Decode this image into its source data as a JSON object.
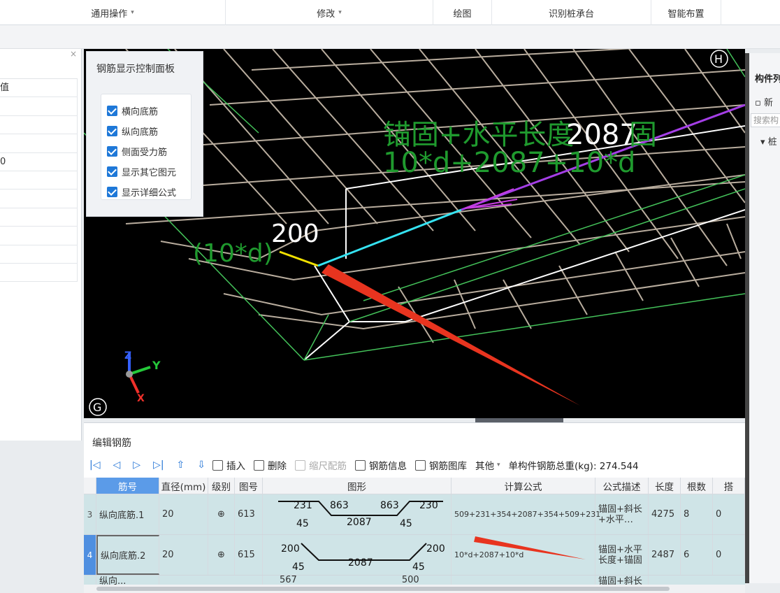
{
  "topbar": {
    "groups": [
      {
        "label": "通用操作",
        "caret": "▾"
      },
      {
        "label": "修改",
        "caret": "▾"
      },
      {
        "label": "绘图",
        "caret": ""
      },
      {
        "label": "识别桩承台",
        "caret": ""
      },
      {
        "label": "智能布置",
        "caret": ""
      }
    ]
  },
  "left_panel": {
    "close": "×",
    "rows": [
      "值",
      "",
      "",
      "",
      "0",
      "",
      "",
      "",
      "",
      "",
      ""
    ]
  },
  "viewport": {
    "anno_line1": "锚固+水平长度",
    "anno_value": "2087",
    "anno_tail": "固",
    "anno_line2": "10*d+2087+10*d",
    "dim_200": "200",
    "dim_10d": "(10*d)",
    "corner_h": "H",
    "corner_g": "G",
    "axis_x": "X",
    "axis_y": "Y",
    "axis_z": "Z"
  },
  "control_panel": {
    "title": "钢筋显示控制面板",
    "items": [
      {
        "label": "横向底筋",
        "checked": true
      },
      {
        "label": "纵向底筋",
        "checked": true
      },
      {
        "label": "侧面受力筋",
        "checked": true
      },
      {
        "label": "显示其它图元",
        "checked": true
      },
      {
        "label": "显示详细公式",
        "checked": true
      }
    ]
  },
  "right_panel": {
    "title": "构件列",
    "new_label": "新",
    "search_placeholder": "搜索构",
    "tree_item": "▾ 桩"
  },
  "bottom": {
    "title": "编辑钢筋",
    "toolbar": {
      "insert": "插入",
      "delete": "删除",
      "scale": "缩尺配筋",
      "rebar_info": "钢筋信息",
      "rebar_lib": "钢筋图库",
      "other": "其他",
      "total_label": "单构件钢筋总重(kg): 274.544"
    },
    "columns": [
      "筋号",
      "直径(mm)",
      "级别",
      "图号",
      "图形",
      "计算公式",
      "公式描述",
      "长度",
      "根数",
      "搭"
    ],
    "rows": [
      {
        "index": "3",
        "name": "纵向底筋.1",
        "diameter": "20",
        "grade": "⊕",
        "fig_no": "613",
        "shape": {
          "a": "231",
          "b": "863",
          "c": "863",
          "d": "230",
          "e": "45",
          "f": "2087",
          "g": "45"
        },
        "formula": "509+231+354+2087+354+509+231",
        "desc": "锚固+斜长+水平…",
        "length": "4275",
        "count": "8",
        "lap": "0"
      },
      {
        "index": "4",
        "name": "纵向底筋.2",
        "diameter": "20",
        "grade": "⊕",
        "fig_no": "615",
        "shape": {
          "a": "200",
          "d": "200",
          "e": "45",
          "f": "2087",
          "g": "45"
        },
        "formula": "10*d+2087+10*d",
        "desc": "锚固+水平长度+锚固",
        "length": "2487",
        "count": "6",
        "lap": "0"
      }
    ],
    "partial_row": {
      "name": "纵向...",
      "shape_a": "567",
      "shape_d": "500",
      "desc": "锚固+斜长"
    }
  }
}
